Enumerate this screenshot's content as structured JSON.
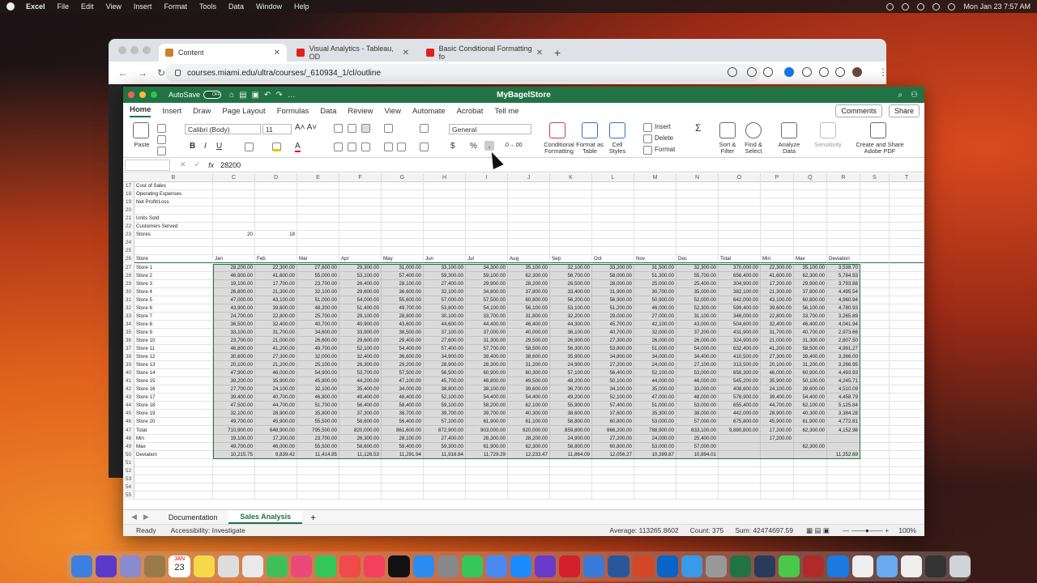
{
  "menubar": {
    "app": "Excel",
    "items": [
      "File",
      "Edit",
      "View",
      "Insert",
      "Format",
      "Tools",
      "Data",
      "Window",
      "Help"
    ],
    "clock": "Mon Jan 23  7:57 AM"
  },
  "browser": {
    "tabs": [
      {
        "label": "Content",
        "active": true
      },
      {
        "label": "Visual Analytics - Tableau, OD",
        "active": false
      },
      {
        "label": "Basic Conditional Formatting fo",
        "active": false
      }
    ],
    "url": "courses.miami.edu/ultra/courses/_610934_1/cl/outline"
  },
  "excel": {
    "title": "MyBagelStore",
    "autosave": "AutoSave",
    "autosave_state": "OFF",
    "ribbon_tabs": [
      "Home",
      "Insert",
      "Draw",
      "Page Layout",
      "Formulas",
      "Data",
      "Review",
      "View",
      "Automate",
      "Acrobat",
      "Tell me"
    ],
    "comments": "Comments",
    "share": "Share",
    "font": "Calibri (Body)",
    "font_size": "11",
    "number_format": "General",
    "paste": "Paste",
    "ribbon_labels": {
      "cond": "Conditional Formatting",
      "fmt_table": "Format as Table",
      "cell_styles": "Cell Styles",
      "insert": "Insert",
      "delete": "Delete",
      "format": "Format",
      "sort": "Sort & Filter",
      "find": "Find & Select",
      "analyze": "Analyze Data",
      "sensitivity": "Sensitivity",
      "adobe": "Create and Share Adobe PDF"
    },
    "formula_value": "28200",
    "fx": "fx",
    "columns": [
      "B",
      "C",
      "D",
      "E",
      "F",
      "G",
      "H",
      "I",
      "J",
      "K",
      "L",
      "M",
      "N",
      "O",
      "P",
      "Q",
      "R",
      "S",
      "T"
    ],
    "top_rows": [
      {
        "n": "17",
        "label": "Cost of Sales"
      },
      {
        "n": "18",
        "label": "Operating Expenses"
      },
      {
        "n": "19",
        "label": "Net Profit/Loss"
      },
      {
        "n": "20",
        "label": ""
      },
      {
        "n": "21",
        "label": "Units Sold"
      },
      {
        "n": "22",
        "label": "Customers Served"
      },
      {
        "n": "23",
        "label": "Stores",
        "c": "20",
        "d": "18"
      },
      {
        "n": "24",
        "label": ""
      },
      {
        "n": "25",
        "label": ""
      }
    ],
    "header_row": {
      "n": "26",
      "cells": [
        "Store",
        "Jan",
        "Feb",
        "Mar",
        "Apr",
        "May",
        "Jun",
        "Jul",
        "Aug",
        "Sep",
        "Oct",
        "Nov",
        "Dec",
        "Total",
        "Min",
        "Max",
        "Deviation"
      ]
    },
    "data_rows": [
      {
        "n": "27",
        "cells": [
          "Store 1",
          "28,200.00",
          "22,300.00",
          "27,600.00",
          "29,300.00",
          "31,000.00",
          "33,100.00",
          "34,300.00",
          "35,100.00",
          "32,100.00",
          "33,200.00",
          "31,500.00",
          "32,300.00",
          "370,000.00",
          "22,300.00",
          "35,100.00",
          "3,538.70"
        ]
      },
      {
        "n": "28",
        "cells": [
          "Store 2",
          "46,900.00",
          "41,600.00",
          "55,000.00",
          "53,100.00",
          "57,400.00",
          "59,300.00",
          "59,100.00",
          "62,300.00",
          "56,700.00",
          "58,000.00",
          "51,300.00",
          "55,700.00",
          "656,400.00",
          "41,600.00",
          "62,300.00",
          "5,784.93"
        ]
      },
      {
        "n": "29",
        "cells": [
          "Store 3",
          "19,100.00",
          "17,700.00",
          "23,700.00",
          "26,400.00",
          "28,100.00",
          "27,400.00",
          "29,900.00",
          "28,200.00",
          "26,500.00",
          "28,000.00",
          "25,000.00",
          "25,400.00",
          "304,900.00",
          "17,200.00",
          "29,900.00",
          "3,793.88"
        ]
      },
      {
        "n": "30",
        "cells": [
          "Store 4",
          "26,800.00",
          "21,300.00",
          "32,100.00",
          "29,600.00",
          "36,600.00",
          "32,100.00",
          "34,800.00",
          "37,800.00",
          "33,400.00",
          "31,900.00",
          "30,700.00",
          "35,000.00",
          "382,100.00",
          "21,300.00",
          "37,800.00",
          "4,495.54"
        ]
      },
      {
        "n": "31",
        "cells": [
          "Store 5",
          "47,000.00",
          "43,100.00",
          "51,000.00",
          "54,000.00",
          "55,600.00",
          "57,000.00",
          "57,500.00",
          "60,800.00",
          "56,200.00",
          "56,900.00",
          "50,900.00",
          "52,000.00",
          "642,000.00",
          "43,100.00",
          "60,800.00",
          "4,960.94"
        ]
      },
      {
        "n": "32",
        "cells": [
          "Store 6",
          "43,900.00",
          "39,600.00",
          "48,200.00",
          "51,400.00",
          "49,700.00",
          "53,800.00",
          "54,100.00",
          "56,100.00",
          "53,100.00",
          "51,200.00",
          "46,000.00",
          "52,300.00",
          "599,400.00",
          "39,600.00",
          "56,100.00",
          "4,780.93"
        ]
      },
      {
        "n": "33",
        "cells": [
          "Store 7",
          "24,700.00",
          "22,800.00",
          "25,700.00",
          "29,100.00",
          "28,800.00",
          "30,100.00",
          "33,700.00",
          "31,800.00",
          "32,200.00",
          "29,000.00",
          "27,000.00",
          "31,100.00",
          "346,000.00",
          "22,800.00",
          "33,700.00",
          "3,265.89"
        ]
      },
      {
        "n": "34",
        "cells": [
          "Store 8",
          "36,500.00",
          "32,400.00",
          "40,700.00",
          "40,900.00",
          "43,600.00",
          "44,600.00",
          "44,400.00",
          "46,400.00",
          "44,300.00",
          "45,700.00",
          "42,100.00",
          "43,000.00",
          "504,600.00",
          "32,400.00",
          "46,400.00",
          "4,041.94"
        ]
      },
      {
        "n": "35",
        "cells": [
          "Store 9",
          "33,100.00",
          "31,700.00",
          "34,600.00",
          "33,900.00",
          "38,500.00",
          "37,100.00",
          "37,000.00",
          "40,000.00",
          "36,100.00",
          "40,700.00",
          "32,000.00",
          "37,200.00",
          "431,900.00",
          "31,700.00",
          "40,700.00",
          "2,973.66"
        ]
      },
      {
        "n": "36",
        "cells": [
          "Store 10",
          "23,700.00",
          "21,000.00",
          "26,600.00",
          "29,600.00",
          "29,400.00",
          "27,600.00",
          "31,300.00",
          "29,500.00",
          "26,900.00",
          "27,300.00",
          "26,000.00",
          "26,000.00",
          "324,900.00",
          "21,000.00",
          "31,300.00",
          "2,807.50"
        ]
      },
      {
        "n": "37",
        "cells": [
          "Store 11",
          "46,800.00",
          "41,200.00",
          "49,700.00",
          "52,100.00",
          "54,400.00",
          "57,400.00",
          "57,700.00",
          "58,500.00",
          "56,300.00",
          "53,800.00",
          "51,000.00",
          "54,000.00",
          "632,400.00",
          "41,200.00",
          "58,500.00",
          "4,991.27"
        ]
      },
      {
        "n": "38",
        "cells": [
          "Store 12",
          "30,600.00",
          "27,300.00",
          "32,000.00",
          "32,400.00",
          "36,600.00",
          "34,900.00",
          "39,400.00",
          "38,600.00",
          "35,900.00",
          "34,800.00",
          "34,000.00",
          "34,400.00",
          "410,500.00",
          "27,300.00",
          "39,400.00",
          "3,366.00"
        ]
      },
      {
        "n": "39",
        "cells": [
          "Store 13",
          "20,100.00",
          "21,200.00",
          "25,100.00",
          "26,300.00",
          "29,200.00",
          "28,900.00",
          "28,300.00",
          "31,200.00",
          "24,900.00",
          "27,200.00",
          "24,000.00",
          "27,100.00",
          "313,500.00",
          "20,100.00",
          "31,200.00",
          "3,266.95"
        ]
      },
      {
        "n": "40",
        "cells": [
          "Store 14",
          "47,900.00",
          "46,000.00",
          "54,900.00",
          "53,700.00",
          "57,500.00",
          "56,500.00",
          "60,900.00",
          "60,300.00",
          "57,100.00",
          "56,400.00",
          "52,100.00",
          "53,000.00",
          "656,300.00",
          "46,000.00",
          "60,900.00",
          "4,493.93"
        ]
      },
      {
        "n": "41",
        "cells": [
          "Store 15",
          "39,200.00",
          "35,900.00",
          "45,800.00",
          "44,200.00",
          "47,100.00",
          "45,700.00",
          "48,800.00",
          "49,500.00",
          "48,200.00",
          "50,100.00",
          "44,000.00",
          "46,000.00",
          "545,200.00",
          "35,900.00",
          "50,100.00",
          "4,245.71"
        ]
      },
      {
        "n": "42",
        "cells": [
          "Store 16",
          "27,700.00",
          "24,100.00",
          "32,100.00",
          "35,400.00",
          "34,000.00",
          "38,800.00",
          "38,100.00",
          "39,600.00",
          "36,700.00",
          "34,100.00",
          "35,000.00",
          "33,000.00",
          "408,600.00",
          "24,100.00",
          "39,600.00",
          "4,510.09"
        ]
      },
      {
        "n": "43",
        "cells": [
          "Store 17",
          "39,400.00",
          "40,700.00",
          "46,800.00",
          "49,400.00",
          "48,400.00",
          "52,100.00",
          "54,400.00",
          "54,400.00",
          "49,200.00",
          "52,100.00",
          "47,000.00",
          "48,000.00",
          "578,900.00",
          "39,400.00",
          "54,400.00",
          "4,458.79"
        ]
      },
      {
        "n": "44",
        "cells": [
          "Store 18",
          "47,500.00",
          "44,700.00",
          "51,700.00",
          "56,400.00",
          "58,400.00",
          "59,100.00",
          "58,200.00",
          "62,100.00",
          "55,900.00",
          "57,400.00",
          "51,000.00",
          "53,000.00",
          "655,400.00",
          "44,700.00",
          "62,100.00",
          "5,125.84"
        ]
      },
      {
        "n": "45",
        "cells": [
          "Store 19",
          "32,100.00",
          "28,900.00",
          "35,800.00",
          "37,300.00",
          "38,700.00",
          "39,700.00",
          "39,700.00",
          "40,300.00",
          "38,600.00",
          "37,600.00",
          "35,300.00",
          "38,000.00",
          "442,000.00",
          "28,900.00",
          "40,300.00",
          "3,384.28"
        ]
      },
      {
        "n": "46",
        "cells": [
          "Store 20",
          "49,700.00",
          "45,900.00",
          "55,500.00",
          "58,600.00",
          "56,400.00",
          "57,100.00",
          "61,900.00",
          "61,100.00",
          "58,800.00",
          "60,800.00",
          "53,000.00",
          "57,000.00",
          "675,800.00",
          "45,900.00",
          "61,900.00",
          "4,772.81"
        ]
      },
      {
        "n": "47",
        "cells": [
          "Total",
          "710,900.00",
          "648,900.00",
          "795,500.00",
          "820,000.00",
          "861,600.00",
          "872,900.00",
          "903,000.00",
          "920,000.00",
          "859,800.00",
          "866,200.00",
          "788,900.00",
          "833,100.00",
          "9,880,800.00",
          "17,200.00",
          "62,300.00",
          "4,152.98"
        ]
      },
      {
        "n": "48",
        "cells": [
          "Min",
          "19,100.00",
          "17,200.00",
          "23,700.00",
          "26,300.00",
          "28,100.00",
          "27,400.00",
          "28,300.00",
          "28,200.00",
          "24,900.00",
          "27,200.00",
          "24,000.00",
          "25,400.00",
          "",
          "17,200.00",
          "",
          ""
        ]
      },
      {
        "n": "49",
        "cells": [
          "Max",
          "49,700.00",
          "46,000.00",
          "55,500.00",
          "58,600.00",
          "58,400.00",
          "59,300.00",
          "61,900.00",
          "62,300.00",
          "58,800.00",
          "60,800.00",
          "53,000.00",
          "57,000.00",
          "",
          "",
          "62,300.00",
          ""
        ]
      },
      {
        "n": "50",
        "cells": [
          "Deviation",
          "10,215.75",
          "9,839.42",
          "11,414.85",
          "11,126.53",
          "11,291.94",
          "11,916.84",
          "11,729.29",
          "12,233.47",
          "11,864.09",
          "12,056.27",
          "10,399.87",
          "10,894.01",
          "",
          "",
          "",
          "11,252.69"
        ]
      }
    ],
    "empty_rows": [
      "51",
      "52",
      "53",
      "54",
      "55"
    ],
    "sheets": [
      "Documentation",
      "Sales Analysis"
    ],
    "status": {
      "ready": "Ready",
      "accessibility": "Accessibility: Investigate",
      "average": "Average: 113265.8602",
      "count": "Count: 375",
      "sum": "Sum: 42474697.59",
      "zoom": "100%"
    }
  },
  "dock": {
    "calendar_month": "JAN",
    "calendar_day": "23"
  }
}
